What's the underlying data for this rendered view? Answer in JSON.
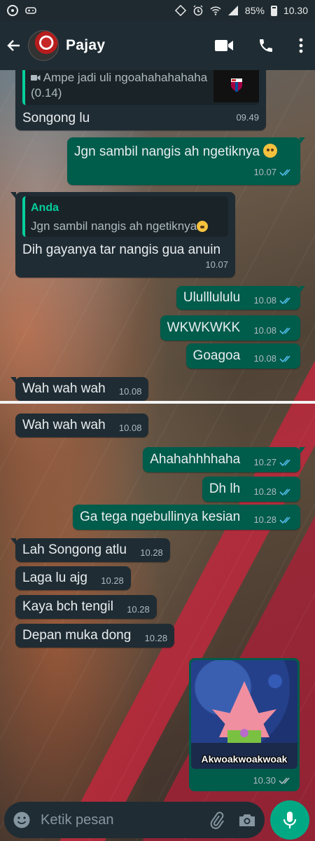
{
  "status_bar": {
    "battery": "85%",
    "time": "10.30"
  },
  "header": {
    "contact_name": "Pajay"
  },
  "messages": [
    {
      "dir": "in",
      "quote_text": "Ampe jadi uli ngoahahahahaha",
      "quote_sub": "(0.14)",
      "text": "Songong lu",
      "time": "09.49"
    },
    {
      "dir": "out",
      "text": "Jgn sambil nangis ah ngetiknya",
      "time": "10.07"
    },
    {
      "dir": "in",
      "quote_name": "Anda",
      "quote_text": "Jgn sambil nangis ah ngetiknya",
      "text": "Dih gayanya tar nangis gua anuin",
      "time": "10.07"
    },
    {
      "dir": "out",
      "text": "Ululllululu",
      "time": "10.08"
    },
    {
      "dir": "out",
      "text": "WKWKWKK",
      "time": "10.08"
    },
    {
      "dir": "out",
      "text": "Goagoa",
      "time": "10.08"
    },
    {
      "dir": "in",
      "text": "Wah wah wah",
      "time": "10.08"
    },
    {
      "dir": "in",
      "text": "Wah wah wah",
      "time": "10.08"
    },
    {
      "dir": "out",
      "text": "Ahahahhhhaha",
      "time": "10.27"
    },
    {
      "dir": "out",
      "text": "Dh lh",
      "time": "10.28"
    },
    {
      "dir": "out",
      "text": "Ga tega ngebullinya kesian",
      "time": "10.28"
    },
    {
      "dir": "in",
      "text": "Lah Songong atlu",
      "time": "10.28"
    },
    {
      "dir": "in",
      "text": "Laga lu ajg",
      "time": "10.28"
    },
    {
      "dir": "in",
      "text": "Kaya bch tengil",
      "time": "10.28"
    },
    {
      "dir": "in",
      "text": "Depan muka dong",
      "time": "10.28"
    },
    {
      "dir": "out",
      "image_caption": "Akwoakwoakwoak",
      "time": "10.30"
    }
  ],
  "input": {
    "placeholder": "Ketik pesan"
  },
  "colors": {
    "outgoing_bubble": "#005c4b",
    "incoming_bubble": "#1f2c34",
    "accent": "#00a884",
    "read_ticks": "#53bdeb"
  }
}
